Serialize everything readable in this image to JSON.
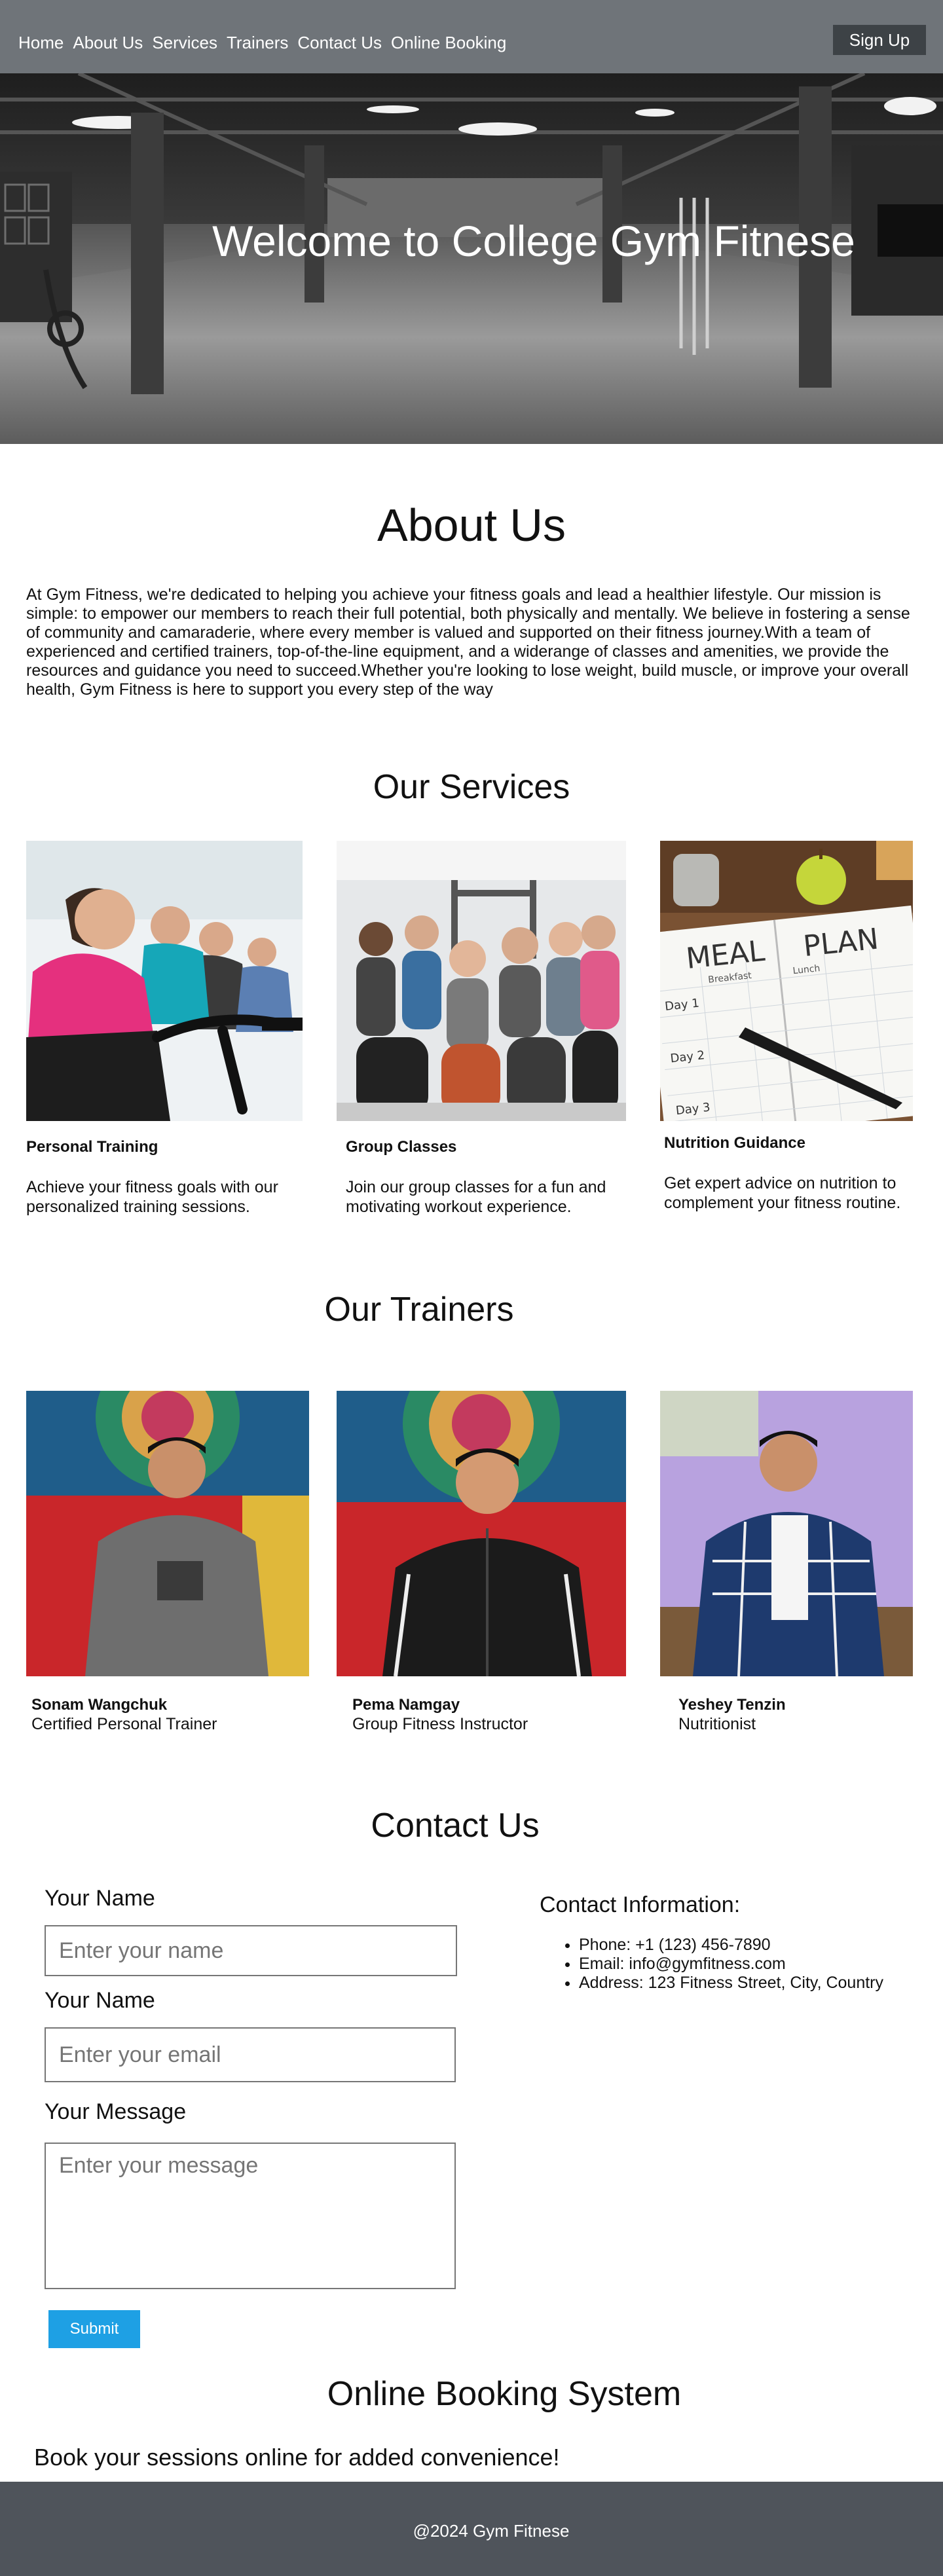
{
  "nav": {
    "links": [
      "Home",
      "About Us",
      "Services",
      "Trainers",
      "Contact Us",
      "Online Booking"
    ],
    "signup_label": "Sign Up"
  },
  "hero": {
    "title": "Welcome to College Gym Fitnese"
  },
  "about": {
    "title": "About Us",
    "text": "At Gym Fitness, we're dedicated to helping you achieve your fitness goals and lead a healthier lifestyle. Our mission is simple: to empower our members to reach their full potential, both physically and mentally. We believe in fostering a sense of community and camaraderie, where every member is valued and supported on their fitness journey.With a team of experienced and certified trainers, top-of-the-line equipment, and a widerange of classes and amenities, we provide the resources and guidance you need to succeed.Whether you're looking to lose weight, build muscle, or improve your overall health, Gym Fitness is here to support you every step of the way"
  },
  "services": {
    "title": "Our Services",
    "items": [
      {
        "name": "Personal Training",
        "desc": "Achieve your fitness goals with our personalized training sessions."
      },
      {
        "name": "Group Classes",
        "desc": "Join our group classes for a fun and motivating workout experience."
      },
      {
        "name": "Nutrition Guidance",
        "desc": "Get expert advice on nutrition to complement your fitness routine."
      }
    ],
    "meal_plan": {
      "meal": "MEAL",
      "plan": "PLAN",
      "breakfast": "Breakfast",
      "lunch": "Lunch",
      "day1": "Day 1",
      "day2": "Day 2",
      "day3": "Day 3"
    }
  },
  "trainers": {
    "title": "Our Trainers",
    "items": [
      {
        "name": "Sonam Wangchuk",
        "role": "Certified Personal Trainer"
      },
      {
        "name": "Pema Namgay",
        "role": "Group Fitness Instructor"
      },
      {
        "name": "Yeshey Tenzin",
        "role": "Nutritionist"
      }
    ]
  },
  "contact": {
    "title": "Contact Us",
    "name_label": "Your Name",
    "name_placeholder": "Enter your name",
    "email_label": "Your Name",
    "email_placeholder": "Enter your email",
    "message_label": "Your Message",
    "message_placeholder": "Enter your message",
    "submit_label": "Submit",
    "info_title": "Contact Information:",
    "phone": "Phone: +1 (123) 456-7890",
    "email": "Email: info@gymfitness.com",
    "address": "Address: 123 Fitness Street, City, Country"
  },
  "booking": {
    "title": "Online Booking  System",
    "text": "Book your sessions online for added convenience!"
  },
  "footer": {
    "text": "@2024 Gym Fitnese"
  },
  "colors": {
    "nav_bg": "#6f7479",
    "signup_bg": "#3d4246",
    "submit_bg": "#1ea0e4",
    "footer_bg": "#4f545b"
  }
}
